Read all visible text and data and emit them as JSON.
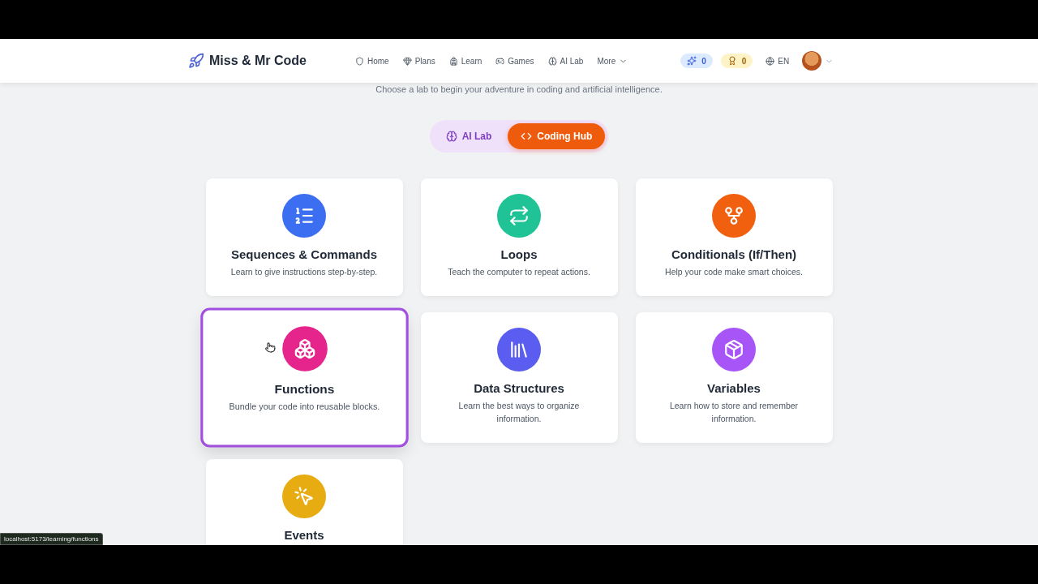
{
  "brand": {
    "name": "Miss & Mr Code"
  },
  "nav": [
    {
      "label": "Home",
      "kind": "home"
    },
    {
      "label": "Plans",
      "kind": "plans"
    },
    {
      "label": "Learn",
      "kind": "learn"
    },
    {
      "label": "Games",
      "kind": "games"
    },
    {
      "label": "AI Lab",
      "kind": "ai"
    },
    {
      "label": "More",
      "kind": "more"
    }
  ],
  "counters": [
    {
      "kind": "sparks",
      "value": "0",
      "color": "#dbeafe"
    },
    {
      "kind": "awards",
      "value": "0",
      "color": "#fef3c7"
    }
  ],
  "language": "EN",
  "subtitle": "Choose a lab to begin your adventure in coding and artificial intelligence.",
  "labs": [
    {
      "label": "AI Lab",
      "kind": "ai",
      "selected": false
    },
    {
      "label": "Coding Hub",
      "kind": "code",
      "selected": true
    }
  ],
  "cards": [
    {
      "title": "Sequences & Commands",
      "description": "Learn to give instructions step-by-step.",
      "kind": "sequence",
      "color": "#3b6ef0",
      "selected": false
    },
    {
      "title": "Loops",
      "description": "Teach the computer to repeat actions.",
      "kind": "loop",
      "color": "#1fc396",
      "selected": false
    },
    {
      "title": "Conditionals (If/Then)",
      "description": "Help your code make smart choices.",
      "kind": "branch",
      "color": "#f0600f",
      "selected": false
    },
    {
      "title": "Functions",
      "description": "Bundle your code into reusable blocks.",
      "kind": "blocks",
      "color": "#e5248c",
      "selected": true
    },
    {
      "title": "Data Structures",
      "description": "Learn the best ways to organize information.",
      "kind": "library",
      "color": "#5b5cf0",
      "selected": false
    },
    {
      "title": "Variables",
      "description": "Learn how to store and remember information.",
      "kind": "package",
      "color": "#a855f7",
      "selected": false
    },
    {
      "title": "Events",
      "kind": "click",
      "color": "#e6ac12",
      "selected": false
    }
  ],
  "status_url": "localhost:5173/learning/functions"
}
